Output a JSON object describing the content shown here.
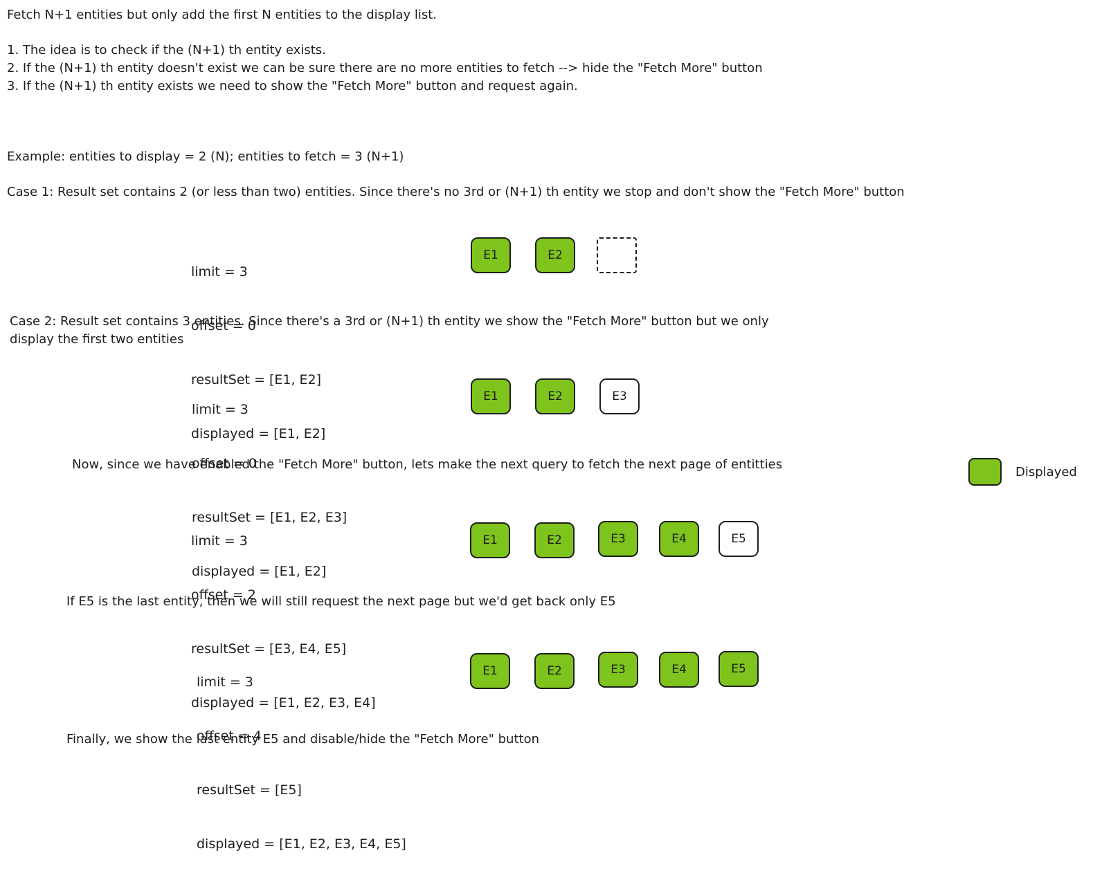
{
  "intro": {
    "title": "Fetch N+1 entities but only add the first N entities to the display list.",
    "points": [
      "1. The idea is to check if the (N+1) th entity exists.",
      "2. If the (N+1) th entity doesn't exist we can be sure there are no more entities to fetch --> hide the \"Fetch More\" button",
      "3. If the (N+1) th entity exists we need to show the \"Fetch More\" button and request again."
    ]
  },
  "example_line": "Example: entities to display = 2 (N); entities to fetch = 3 (N+1)",
  "case1": {
    "heading": "Case 1: Result set contains 2 (or less than two) entities. Since there's no 3rd or (N+1) th entity we stop and don't show the \"Fetch More\" button",
    "params": [
      "limit = 3",
      "offset = 0",
      "resultSet = [E1, E2]",
      "displayed = [E1, E2]"
    ],
    "boxes": [
      "E1",
      "E2",
      ""
    ]
  },
  "case2": {
    "heading_line1": "Case 2: Result set contains 3 entities. Since there's a 3rd or (N+1) th entity we show the \"Fetch More\" button but we only",
    "heading_line2": "display the first two entities",
    "params": [
      "limit = 3",
      "offset = 0",
      "resultSet = [E1, E2, E3]",
      "displayed = [E1, E2]"
    ],
    "boxes": [
      "E1",
      "E2",
      "E3"
    ]
  },
  "step3": {
    "heading": "Now, since we have enabled the \"Fetch More\" button, lets make the next query to fetch the next page of entitties",
    "params": [
      "limit = 3",
      "offset = 2",
      "resultSet = [E3, E4, E5]",
      "displayed = [E1, E2, E3, E4]"
    ],
    "boxes": [
      "E1",
      "E2",
      "E3",
      "E4",
      "E5"
    ]
  },
  "step4": {
    "heading": "If E5 is the last entity, then we will still request the next page but we'd get back only E5",
    "params": [
      "limit = 3",
      "offset = 4",
      "resultSet = [E5]",
      "displayed = [E1, E2, E3, E4, E5]"
    ],
    "boxes": [
      "E1",
      "E2",
      "E3",
      "E4",
      "E5"
    ]
  },
  "final_line": "Finally, we show the last entity E5 and disable/hide the \"Fetch More\" button",
  "legend": {
    "label": "Displayed",
    "color": "#7ec41c"
  },
  "colors": {
    "displayed": "#7ec41c",
    "stroke": "#1e1e1e"
  }
}
